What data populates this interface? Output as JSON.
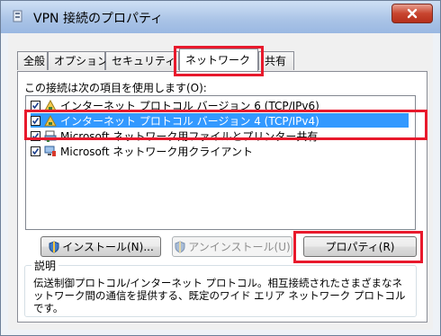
{
  "window": {
    "title": "VPN 接続のプロパティ"
  },
  "tabs": [
    {
      "label": "全般"
    },
    {
      "label": "オプション"
    },
    {
      "label": "セキュリティ"
    },
    {
      "label": "ネットワーク"
    },
    {
      "label": "共有"
    }
  ],
  "panel": {
    "heading": "この接続は次の項目を使用します(O):",
    "items": [
      {
        "label": "インターネット プロトコル バージョン 6 (TCP/IPv6)",
        "checked": true,
        "icon": "network-protocol-icon"
      },
      {
        "label": "インターネット プロトコル バージョン 4 (TCP/IPv4)",
        "checked": true,
        "selected": true,
        "icon": "network-protocol-icon"
      },
      {
        "label": "Microsoft ネットワーク用ファイルとプリンター共有",
        "checked": true,
        "icon": "file-printer-share-icon"
      },
      {
        "label": "Microsoft ネットワーク用クライアント",
        "checked": true,
        "icon": "network-client-icon"
      }
    ],
    "buttons": {
      "install": "インストール(N)...",
      "uninstall": "アンインストール(U)",
      "properties": "プロパティ(R)"
    },
    "description": {
      "legend": "説明",
      "text": "伝送制御プロトコル/インターネット プロトコル。相互接続されたさまざまなネットワーク間の通信を提供する、既定のワイド エリア ネットワーク プロトコルです。"
    }
  },
  "colors": {
    "highlight": "#e8192c",
    "selection": "#3399ff"
  }
}
